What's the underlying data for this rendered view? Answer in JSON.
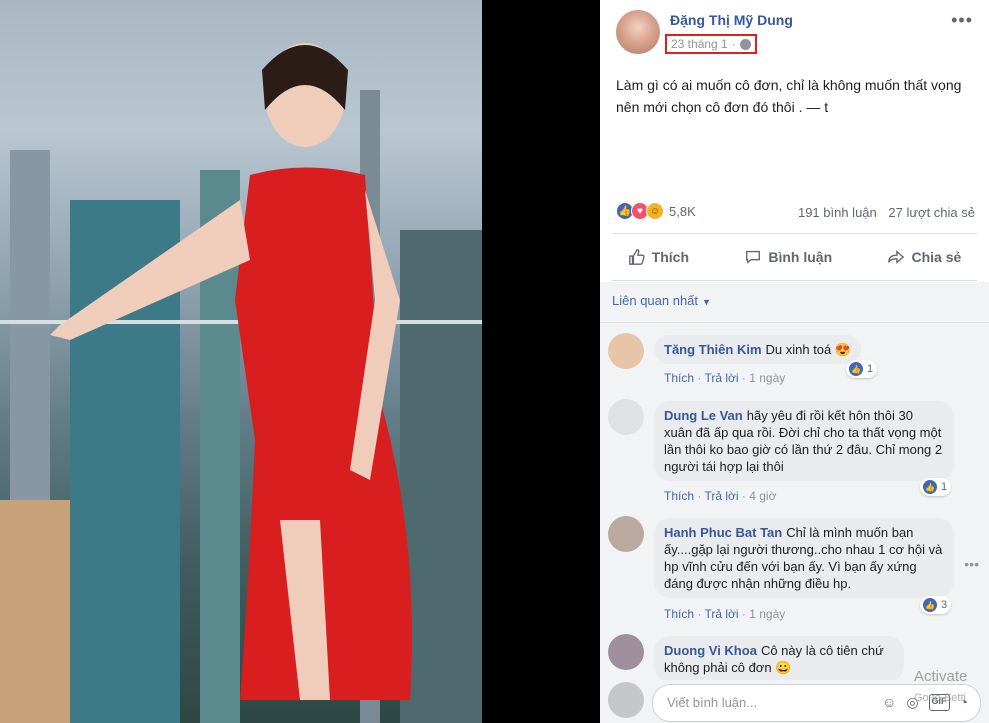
{
  "post": {
    "author": "Đặng Thị Mỹ Dung",
    "timestamp": "23 tháng 1",
    "privacy_icon": "globe-icon",
    "text": "Làm gì có ai muốn cô đơn, chỉ là không muốn thất vọng nên mới chọn cô đơn đó thôi . — t",
    "reaction_count": "5,8K",
    "comment_count": "191 bình luận",
    "share_count": "27 lượt chia sẻ"
  },
  "actions": {
    "like": "Thích",
    "comment": "Bình luận",
    "share": "Chia sẻ"
  },
  "sort_label": "Liên quan nhất",
  "comments": [
    {
      "name": "Tăng Thiên Kim",
      "text": "Du xinh toá 😍",
      "like": "Thích",
      "reply": "Trả lời",
      "time": "1 ngày",
      "likes": "1"
    },
    {
      "name": "Dung Le Van",
      "text": "hãy yêu đi rồi kết hôn thôi 30 xuân đã ấp qua rồi. Đời chỉ cho ta thất vọng một lần thôi ko bao giờ có lần thứ 2 đâu. Chỉ mong 2 người tái hợp lại thôi",
      "like": "Thích",
      "reply": "Trả lời",
      "time": "4 giờ",
      "likes": "1"
    },
    {
      "name": "Hanh Phuc Bat Tan",
      "text": "Chỉ là mình muốn bạn ấy....gặp lại người thương..cho nhau 1 cơ hội và hp vĩnh cửu đến với bạn ấy. Vì bạn ấy xứng đáng được nhận những điều hp.",
      "like": "Thích",
      "reply": "Trả lời",
      "time": "1 ngày",
      "likes": "3"
    },
    {
      "name": "Duong Vi Khoa",
      "text": "Cô này là cô tiên chứ không phải cô đơn 😀"
    }
  ],
  "composer": {
    "placeholder": "Viết bình luận..."
  },
  "watermark": {
    "line1": "Activate",
    "line2": "Go to Setti"
  },
  "colors": {
    "link_blue": "#365899",
    "like_blue": "#4267b2",
    "highlight_red": "#e02020"
  }
}
